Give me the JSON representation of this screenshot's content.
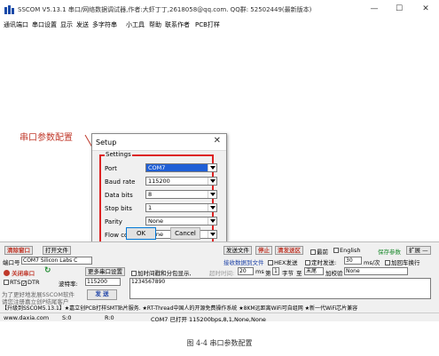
{
  "window": {
    "title": "SSCOM V5.13.1 串口/网络数据调试器,作者:大虾丁丁,2618058@qq.com. QQ群: 52502449(最新版本)",
    "minimize": "—",
    "maximize": "☐",
    "close": "✕"
  },
  "menu": [
    "通讯端口",
    "串口设置",
    "显示",
    "发送",
    "多字符串",
    "小工具",
    "帮助",
    "联系作者",
    "PCB打样"
  ],
  "annotation": {
    "text": "串口参数配置",
    "color": "#c0392b"
  },
  "dialog": {
    "title": "Setup",
    "close": "✕",
    "group_label": "Settings",
    "fields": [
      {
        "label": "Port",
        "value": "COM7"
      },
      {
        "label": "Baud rate",
        "value": "115200"
      },
      {
        "label": "Data bits",
        "value": "8"
      },
      {
        "label": "Stop bits",
        "value": "1"
      },
      {
        "label": "Parity",
        "value": "None"
      },
      {
        "label": "Flow control",
        "value": "None"
      }
    ],
    "ok": "OK",
    "cancel": "Cancel"
  },
  "panel": {
    "clear_window": "清除窗口",
    "open_file": "打开文件",
    "send_file": "发送文件",
    "stop": "停止",
    "clear_send": "清发送区",
    "latest": "最前",
    "english": "English",
    "save_params": "保存参数",
    "expand": "扩展",
    "expand_symbol": "—",
    "port_label": "端口号",
    "port_value": "COM7 Silicon Labs C",
    "rx_to_file": "接收数据到文件",
    "hex_send": "HEX发送",
    "timed_send": "定时发送:",
    "timed_value": "30",
    "timed_unit": "ms/次",
    "add_newline": "加回车换行",
    "close_port": "关闭串口",
    "more_settings": "更多串口设置",
    "timestamp": "加时间戳和分包显示,",
    "timeout_label": "超时时间:",
    "timeout_value": "20",
    "ms_label": "ms",
    "nth_label": "第",
    "byte_value": "1",
    "byte_label": "字节",
    "to_label": "至",
    "end_value": "末尾",
    "checksum_label": "加校验",
    "checksum_value": "None",
    "rts": "RTS",
    "dtr": "DTR",
    "baud_label": "波特率:",
    "baud_value": "115200",
    "send_text": "1234567890",
    "send_button": "发 送",
    "promo_line1": "为了更好地发展SSCOM软件",
    "promo_line2": "请您注册嘉立创P结尾客户",
    "ticker": "【升级到SSCOM5.13.1】★嘉立创PCB打样SMT贴片服务. ★RT-Thread中国人的开源免费操作系统 ★8KM远距离WiFi可自组网 ★新一代WiFi芯片兼容"
  },
  "status": {
    "website": "www.daxia.com",
    "s_count": "S:0",
    "r_count": "R:0",
    "port_state": "COM7 已打开  115200bps,8,1,None,None"
  },
  "caption": "图 4-4  串口参数配置"
}
